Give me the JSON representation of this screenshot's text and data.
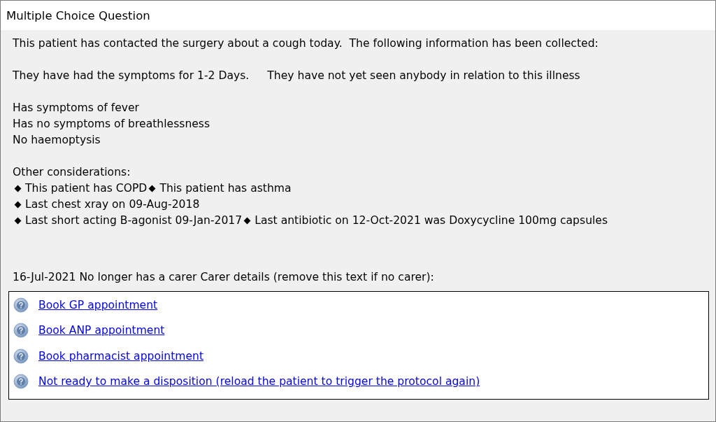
{
  "window": {
    "title": "Multiple Choice Question"
  },
  "intro": "This patient has contacted the surgery about a cough today.  The following information has been collected:",
  "duration": [
    "They have had the symptoms for 1-2 Days.",
    "They have not yet seen anybody in relation to this illness"
  ],
  "symptoms": [
    "Has symptoms of fever",
    "Has no symptoms of breathlessness",
    "No haemoptysis"
  ],
  "considerations_heading": "Other considerations:",
  "considerations": [
    [
      "This patient has COPD",
      "This patient has asthma"
    ],
    [
      "Last chest xray on 09-Aug-2018"
    ],
    [
      "Last short acting B-agonist 09-Jan-2017",
      "Last antibiotic on 12-Oct-2021 was Doxycycline 100mg capsules"
    ]
  ],
  "carer": "16-Jul-2021 No longer has a carer Carer details (remove this text if no carer):",
  "options": [
    {
      "label": "Book GP appointment"
    },
    {
      "label": "Book ANP appointment"
    },
    {
      "label": "Book pharmacist appointment"
    },
    {
      "label": "Not ready to make a disposition (reload the patient to trigger the protocol again)"
    }
  ]
}
